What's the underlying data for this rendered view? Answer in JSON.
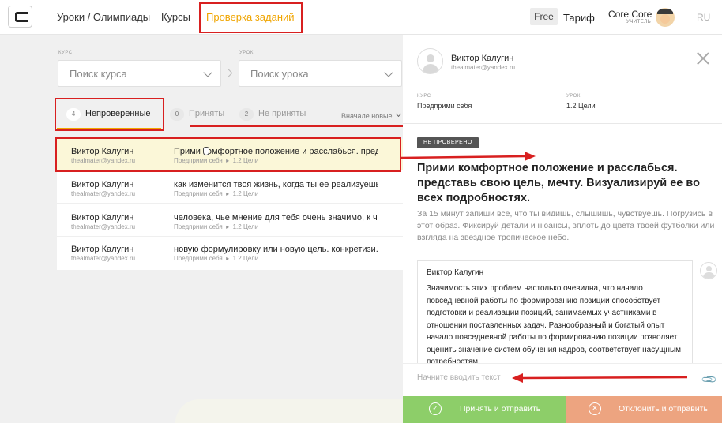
{
  "header": {
    "nav": [
      "Уроки / Олимпиады",
      "Курсы",
      "Проверка заданий"
    ],
    "free_label": "Free",
    "tariff_label": "Тариф",
    "user_name": "Core Core",
    "user_role": "УЧИТЕЛЬ",
    "language": "RU"
  },
  "filters": {
    "course_label": "КУРС",
    "course_placeholder": "Поиск курса",
    "lesson_label": "УРОК",
    "lesson_placeholder": "Поиск урока"
  },
  "tabs": [
    {
      "count": "4",
      "label": "Непроверенные"
    },
    {
      "count": "0",
      "label": "Приняты"
    },
    {
      "count": "2",
      "label": "Не приняты"
    }
  ],
  "sort_label": "Вначале новые",
  "submissions": [
    {
      "name": "Виктор Калугин",
      "email": "thealmater@yandex.ru",
      "task": "Прими комфортное положение и расслабься. пред...",
      "course": "Предприми себя",
      "lesson": "1.2 Цели"
    },
    {
      "name": "Виктор Калугин",
      "email": "thealmater@yandex.ru",
      "task": "как изменится твоя жизнь, когда ты ее реализуешь...",
      "course": "Предприми себя",
      "lesson": "1.2 Цели"
    },
    {
      "name": "Виктор Калугин",
      "email": "thealmater@yandex.ru",
      "task": "человека, чье мнение для тебя очень значимо, к чьи...",
      "course": "Предприми себя",
      "lesson": "1.2 Цели"
    },
    {
      "name": "Виктор Калугин",
      "email": "thealmater@yandex.ru",
      "task": "новую формулировку или новую цель. конкретизи...",
      "course": "Предприми себя",
      "lesson": "1.2 Цели"
    }
  ],
  "detail": {
    "name": "Виктор Калугин",
    "email": "thealmater@yandex.ru",
    "course_label": "КУРС",
    "course_value": "Предприми себя",
    "lesson_label": "УРОК",
    "lesson_value": "1.2 Цели",
    "status": "НЕ ПРОВЕРЕНО",
    "title": "Прими комфортное положение и расслабься. представь свою цель, мечту. Визуализируй ее во всех подробностях.",
    "description": "За 15 минут запиши все, что ты видишь, слышишь, чувствуешь. Погрузись в этот образ. Фиксируй детали и нюансы, вплоть до цвета твоей футболки или взгляда на звездное тропическое небо.",
    "answer_author": "Виктор Калугин",
    "answer_text": "Значимость этих проблем настолько очевидна, что начало повседневной работы по формированию позиции способствует подготовки и реализации позиций, занимаемых участниками в отношении поставленных задач. Разнообразный и богатый опыт начало повседневной работы по формированию позиции позволяет оценить значение систем обучения кадров, соответствует насущным потребностям.",
    "input_placeholder": "Начните вводить текст",
    "accept_label": "Принять и отправить",
    "reject_label": "Отклонить и отправить"
  },
  "colors": {
    "accent": "#f0a500",
    "annotation": "#d82020",
    "accept": "#8dce69",
    "reject": "#eda480"
  }
}
